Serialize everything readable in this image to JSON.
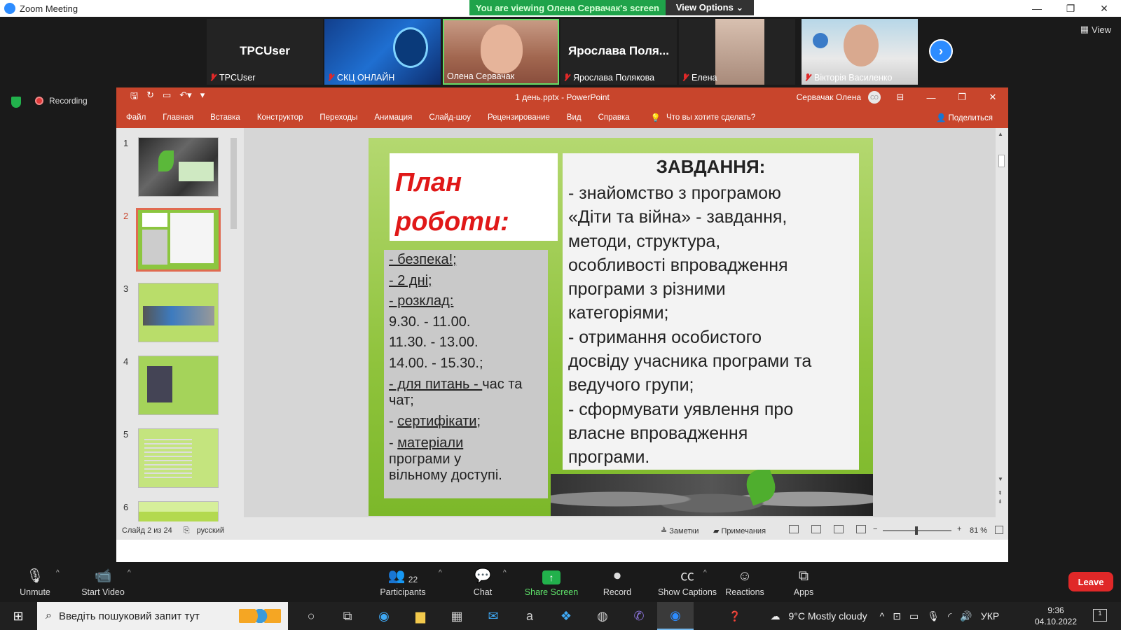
{
  "zoom": {
    "window_title": "Zoom Meeting",
    "viewing_banner": "You are viewing Олена Сервачак's screen",
    "view_options": "View Options ⌄",
    "view_button": "View",
    "recording": "Recording",
    "participants": [
      {
        "big_name": "TPCUser",
        "label": "TPCUser",
        "muted": true
      },
      {
        "big_name": "",
        "label": "СКЦ ОНЛАЙН",
        "muted": true
      },
      {
        "big_name": "",
        "label": "Олена Сервачак",
        "muted": false
      },
      {
        "big_name": "Ярослава Поля...",
        "label": "Ярослава Полякова",
        "muted": true
      },
      {
        "big_name": "",
        "label": "Елена",
        "muted": true
      },
      {
        "big_name": "",
        "label": "Вікторія Василенко",
        "muted": true
      }
    ],
    "toolbar": {
      "unmute": "Unmute",
      "start_video": "Start Video",
      "participants": "Participants",
      "participants_count": "22",
      "chat": "Chat",
      "share_screen": "Share Screen",
      "record": "Record",
      "show_captions": "Show Captions",
      "reactions": "Reactions",
      "apps": "Apps",
      "leave": "Leave"
    }
  },
  "ppt": {
    "doc_title": "1 день.pptx  -  PowerPoint",
    "user": "Сервачак Олена",
    "avatar_initials": "СО",
    "menu": [
      "Файл",
      "Главная",
      "Вставка",
      "Конструктор",
      "Переходы",
      "Анимация",
      "Слайд-шоу",
      "Рецензирование",
      "Вид",
      "Справка"
    ],
    "tell_me": "Что вы хотите сделать?",
    "share": "Поделиться",
    "thumbnails": [
      "1",
      "2",
      "3",
      "4",
      "5",
      "6"
    ],
    "selected_thumbnail": 2,
    "slide": {
      "title_line1": "План",
      "title_line2": "роботи:",
      "left_items": [
        {
          "text": "- безпека!;",
          "underline": true
        },
        {
          "text": "- 2 дні;",
          "underline": true
        },
        {
          "text": "- розклад:",
          "underline": true
        },
        {
          "text": "9.30.   - 11.00.",
          "underline": false
        },
        {
          "text": "11.30. - 13.00.",
          "underline": false
        },
        {
          "text": "14.00. - 15.30.;",
          "underline": false
        }
      ],
      "meal_underlined": "- для питань - ",
      "meal_rest": "час та",
      "meal_line2": "чат;",
      "cert_prefix": "- ",
      "cert_text": "сертифікати",
      "cert_suffix": ";",
      "materials_prefix": "- ",
      "materials_text": "матеріали",
      "materials_line2": "програми у",
      "materials_line3": "вільному доступі.",
      "right_title": "ЗАВДАННЯ:",
      "right_text": "-  знайомство з програмою\n«Діти та війна» - завдання,\nметоди, структура,\nособливості впровадження\nпрограми з різними\nкатегоріями;\n-  отримання особистого\nдосвіду учасника програми та\nведучого групи;\n-  сформувати уявлення  про\nвласне впровадження\nпрограми."
    },
    "status": {
      "slide_of": "Слайд 2 из 24",
      "language": "русский",
      "notes": "Заметки",
      "comments": "Примечания",
      "zoom_pct": "81 %"
    }
  },
  "taskbar": {
    "search_placeholder": "Введіть пошуковий запит тут",
    "weather": "9°C  Mostly cloudy",
    "language": "УКР",
    "time": "9:36",
    "date": "04.10.2022",
    "notification_count": "1"
  }
}
